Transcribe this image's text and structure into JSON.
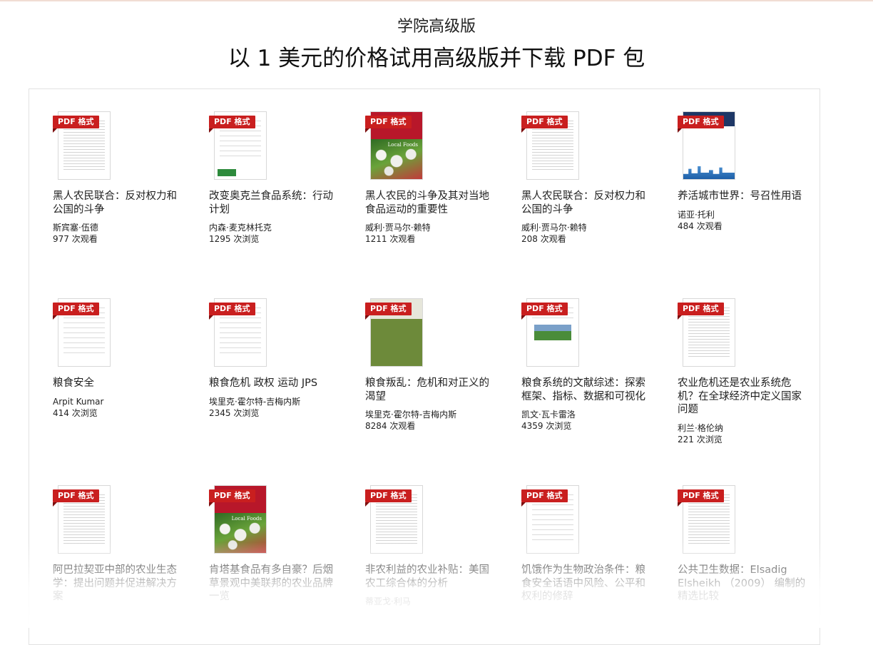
{
  "header": {
    "subtitle": "学院高级版",
    "title": "以 1 美元的价格试用高级版并下载 PDF 包"
  },
  "tag_label": "PDF 格式",
  "colors": {
    "tag": "#c91f1f",
    "border": "#e2e2e2"
  },
  "cards": [
    {
      "title": "黑人农民联合：反对权力和公国的斗争",
      "author": "斯宾塞·伍德",
      "views": "977 次观看",
      "thumb": "doc"
    },
    {
      "title": "改变奥克兰食品系统：行动计划",
      "author": "内森·麦克林托克",
      "views": "1295 次浏览",
      "thumb": "green"
    },
    {
      "title": "黑人农民的斗争及其对当地食品运动的重要性",
      "author": "威利·贾马尔·赖特",
      "views": "1211 次观看",
      "thumb": "local",
      "cover_text": "Local Foods"
    },
    {
      "title": "黑人农民联合：反对权力和公国的斗争",
      "author": "威利·贾马尔·赖特",
      "views": "208 次观看",
      "thumb": "doc"
    },
    {
      "title": "养活城市世界：号召性用语",
      "author": "诺亚·托利",
      "views": "484 次观看",
      "thumb": "city"
    },
    {
      "title": "粮食安全",
      "author": "Arpit Kumar",
      "views": "414 次浏览",
      "thumb": "sparse"
    },
    {
      "title": "粮食危机 政权 运动 JPS",
      "author": "埃里克·霍尔特-吉梅内斯",
      "views": "2345 次浏览",
      "thumb": "sparse"
    },
    {
      "title": "粮食叛乱：危机和对正义的渴望",
      "author": "埃里克·霍尔特-吉梅内斯",
      "views": "8284 次观看",
      "thumb": "food"
    },
    {
      "title": "粮食系统的文献综述：探索框架、指标、数据和可视化",
      "author": "凯文·瓦卡雷洛",
      "views": "4359 次浏览",
      "thumb": "photo"
    },
    {
      "title": "农业危机还是农业系统危机？在全球经济中定义国家问题",
      "author": "利兰·格伦纳",
      "views": "221 次浏览",
      "thumb": "doc"
    },
    {
      "title": "阿巴拉契亚中部的农业生态学：提出问题并促进解决方案",
      "author": "",
      "views": "",
      "thumb": "doc"
    },
    {
      "title": "肯塔基食品有多自豪？后烟草景观中美联邦的农业品牌一览",
      "author": "",
      "views": "",
      "thumb": "local",
      "cover_text": "Local Foods"
    },
    {
      "title": "非农利益的农业补贴：美国农工综合体的分析",
      "author": "蒂亚戈·利马",
      "views": "",
      "thumb": "doc"
    },
    {
      "title": "饥饿作为生物政治条件：粮食安全话语中风险、公平和权利的修辞",
      "author": "",
      "views": "",
      "thumb": "sparse"
    },
    {
      "title": "公共卫生数据：Elsadig Elsheikh （2009） 编制的精选比较",
      "author": "",
      "views": "",
      "thumb": "doc"
    }
  ]
}
